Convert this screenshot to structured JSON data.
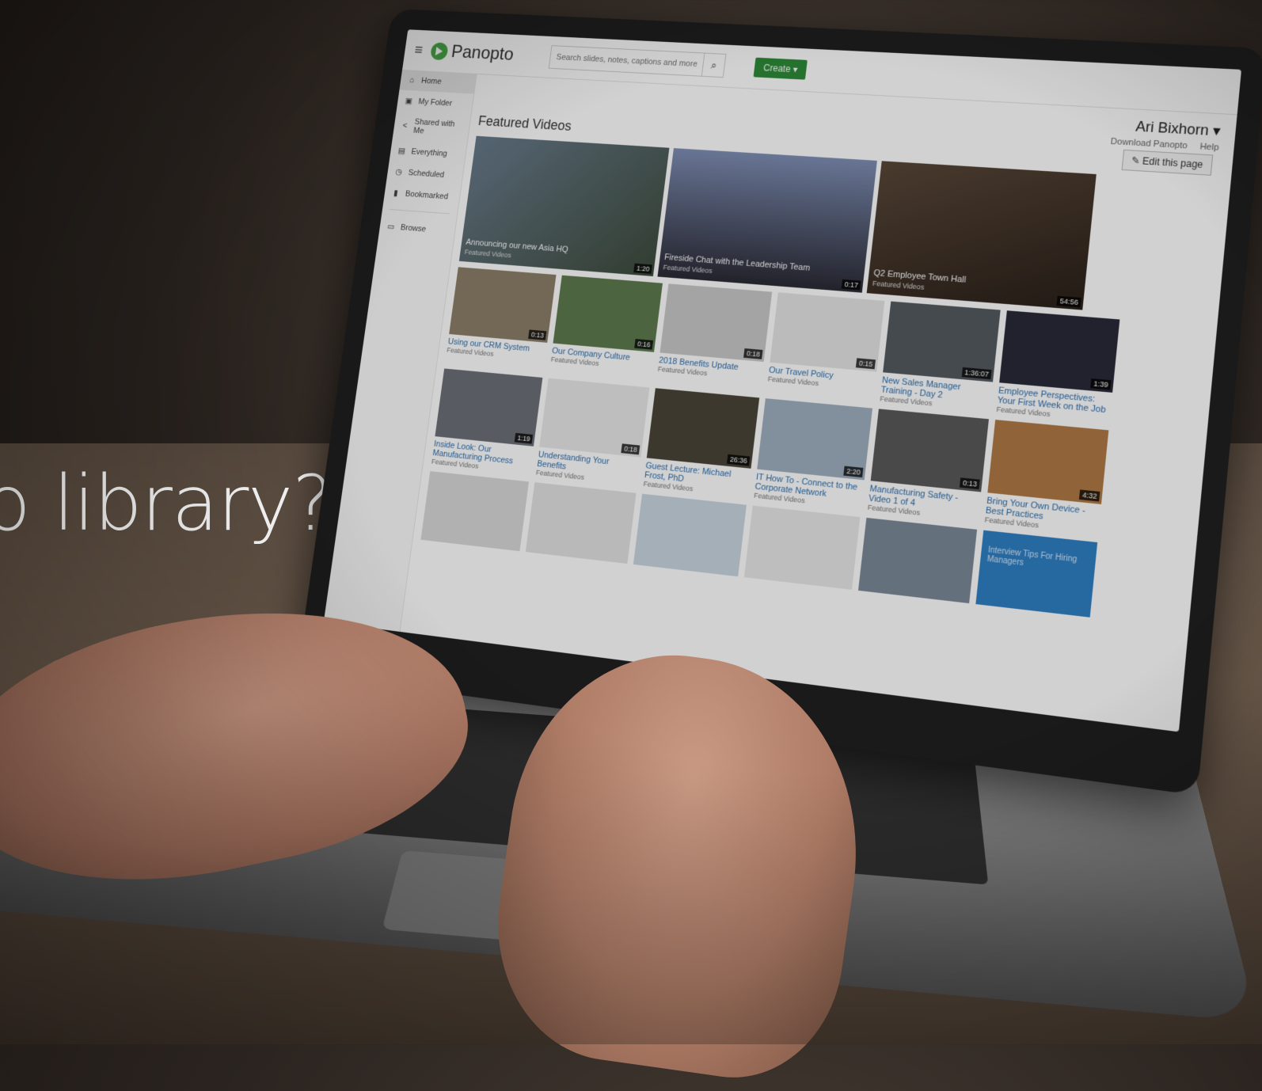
{
  "headline": "o library?",
  "app": {
    "brand": "Panopto",
    "search_placeholder": "Search slides, notes, captions and more",
    "create_label": "Create",
    "user_name": "Ari Bixhorn",
    "download_label": "Download Panopto",
    "help_label": "Help",
    "edit_page_label": "Edit this page",
    "section_title": "Featured Videos",
    "accent_color": "#2e8b3a",
    "link_color": "#2b6fb0"
  },
  "sidebar": {
    "items": [
      {
        "label": "Home",
        "icon": "home-icon"
      },
      {
        "label": "My Folder",
        "icon": "folder-icon"
      },
      {
        "label": "Shared with Me",
        "icon": "share-icon"
      },
      {
        "label": "Everything",
        "icon": "library-icon"
      },
      {
        "label": "Scheduled",
        "icon": "clock-icon"
      },
      {
        "label": "Bookmarked",
        "icon": "bookmark-icon"
      },
      {
        "label": "Browse",
        "icon": "browse-folder-icon"
      }
    ]
  },
  "featured": [
    {
      "title": "Announcing our new Asia HQ",
      "sub": "Featured Videos",
      "duration": "1:20"
    },
    {
      "title": "Fireside Chat with the Leadership Team",
      "sub": "Featured Videos",
      "duration": "0:17"
    },
    {
      "title": "Q2 Employee Town Hall",
      "sub": "Featured Videos",
      "duration": "54:56"
    }
  ],
  "videos_row1": [
    {
      "title": "Using our CRM System",
      "sub": "Featured Videos",
      "duration": "0:13"
    },
    {
      "title": "Our Company Culture",
      "sub": "Featured Videos",
      "duration": "0:16"
    },
    {
      "title": "2018 Benefits Update",
      "sub": "Featured Videos",
      "duration": "0:18"
    },
    {
      "title": "Our Travel Policy",
      "sub": "Featured Videos",
      "duration": "0:15"
    },
    {
      "title": "New Sales Manager Training - Day 2",
      "sub": "Featured Videos",
      "duration": "1:36:07"
    },
    {
      "title": "Employee Perspectives: Your First Week on the Job",
      "sub": "Featured Videos",
      "duration": "1:39"
    }
  ],
  "videos_row2": [
    {
      "title": "Inside Look: Our Manufacturing Process",
      "sub": "Featured Videos",
      "duration": "1:19"
    },
    {
      "title": "Understanding Your Benefits",
      "sub": "Featured Videos",
      "duration": "0:18"
    },
    {
      "title": "Guest Lecture: Michael Frost, PhD",
      "sub": "Featured Videos",
      "duration": "26:36"
    },
    {
      "title": "IT How To - Connect to the Corporate Network",
      "sub": "Featured Videos",
      "duration": "2:20"
    },
    {
      "title": "Manufacturing Safety - Video 1 of 4",
      "sub": "Featured Videos",
      "duration": "0:13"
    },
    {
      "title": "Bring Your Own Device - Best Practices",
      "sub": "Featured Videos",
      "duration": "4:32"
    }
  ],
  "videos_row3_tile_text": "Interview Tips For Hiring Managers"
}
